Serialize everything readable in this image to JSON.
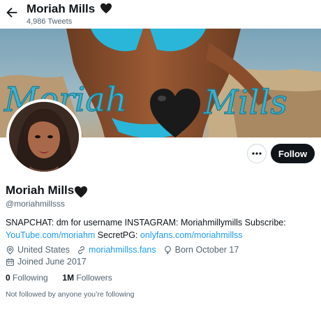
{
  "header": {
    "back_icon": "arrow-left-icon",
    "title": "Moriah Mills",
    "title_emoji": "black-heart-icon",
    "tweet_count": "4,986 Tweets"
  },
  "banner": {
    "script_text_left": "Moriah",
    "script_text_right": "Mills",
    "heart_icon": "black-heart-icon"
  },
  "actions": {
    "more_icon": "more-icon",
    "follow_label": "Follow"
  },
  "profile": {
    "display_name": "Moriah Mills",
    "name_emoji": "black-heart-icon",
    "handle": "@moriahmillsss",
    "bio": {
      "line1": "SNAPCHAT: dm for username INSTAGRAM: Moriahmillymills Subscribe:",
      "link1": "YouTube.com/moriahm",
      "middle": " SecretPG: ",
      "link2": "onlyfans.com/moriahmillss"
    },
    "location": "United States",
    "website": "moriahmillss.fans",
    "birthday": "Born October 17",
    "joined": "Joined June 2017",
    "following_count": "0",
    "following_label": " Following",
    "followers_count": "1M",
    "followers_label": " Followers",
    "followed_by_note": "Not followed by anyone you’re following"
  },
  "colors": {
    "link": "#1d9bf0",
    "button_dark": "#0f1419",
    "secondary_text": "#536471",
    "banner_script": "#3fb3c9"
  }
}
